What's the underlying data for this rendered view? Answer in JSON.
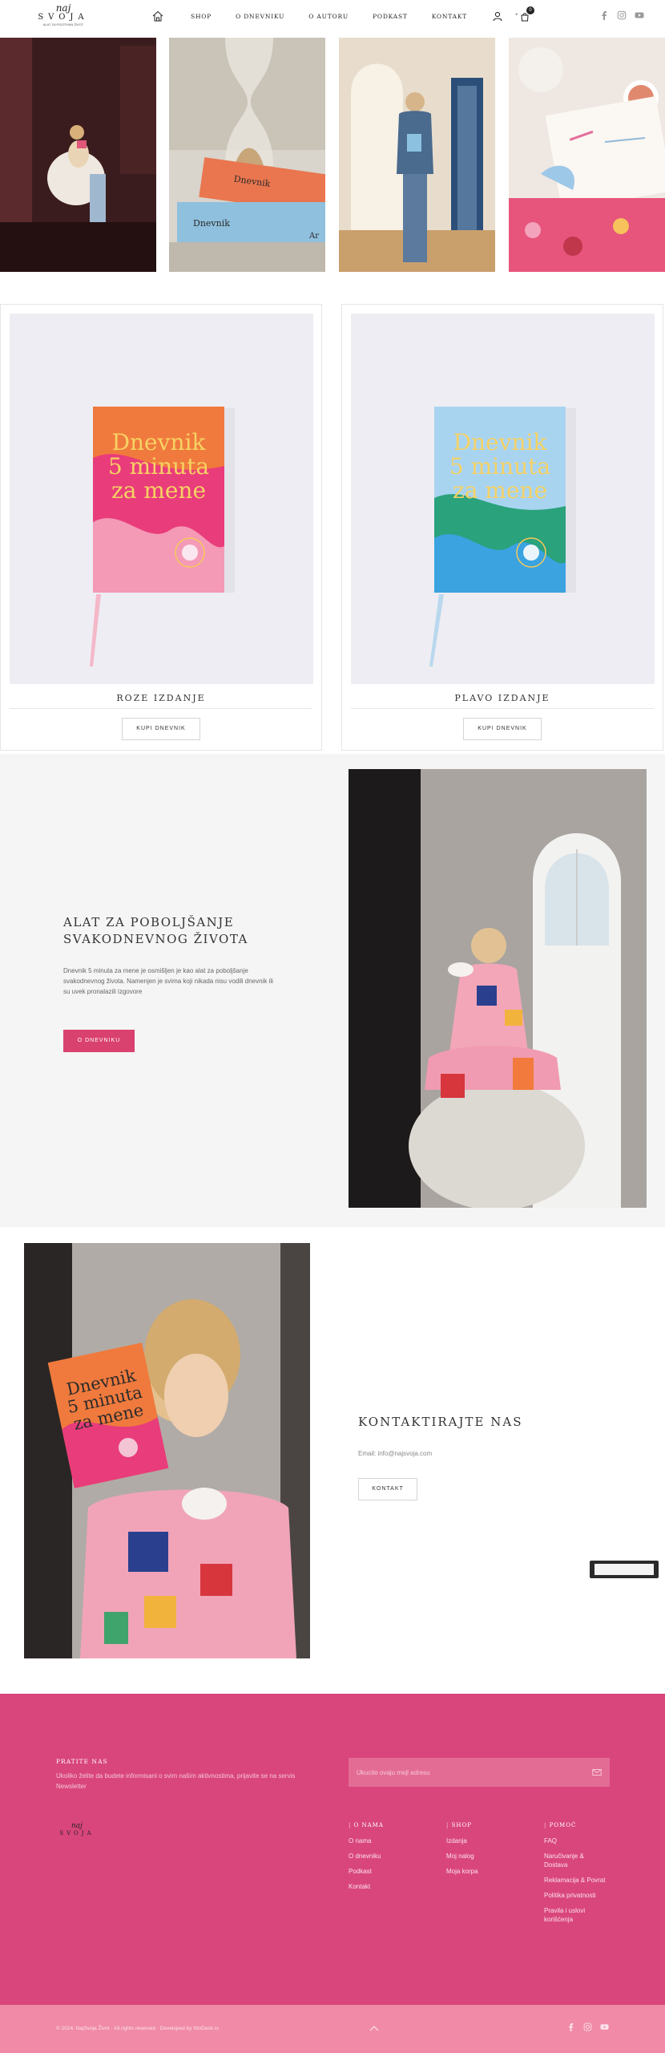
{
  "header": {
    "logo": {
      "line1": "naj",
      "line2": "SVOJA",
      "tagline": "ALAT ZA POZITIVAN ŽIVOT"
    },
    "nav": [
      "SHOP",
      "O DNEVNIKU",
      "O AUTORU",
      "PODKAST",
      "KONTAKT"
    ],
    "cart_plus": "+",
    "cart_count": "0",
    "icons": [
      "home-icon",
      "user-icon",
      "cart-icon",
      "facebook-icon",
      "instagram-icon",
      "youtube-icon"
    ]
  },
  "products": [
    {
      "name": "ROZE IZDANJE",
      "button": "KUPI DNEVNIK",
      "book_title": [
        "Dnevnik",
        "5 minuta",
        "za mene"
      ]
    },
    {
      "name": "PLAVO IZDANJE",
      "button": "KUPI DNEVNIK",
      "book_title": [
        "Dnevnik",
        "5 minuta",
        "za mene"
      ]
    }
  ],
  "strip_texts": {
    "book1": "Dnevnik",
    "book2": "Dnevnik",
    "book2_suffix": "Ar"
  },
  "feature": {
    "title": "ALAT ZA POBOLJŠANJE SVAKODNEVNOG ŽIVOTA",
    "description": "Dnevnik 5 minuta za mene je osmišljen je kao alat za poboljšanje svakodnevnog života. Namenjen je svima koji nikada nisu vodili dnevnik ili su uvek pronalazili izgovore",
    "button": "O DNEVNIKU"
  },
  "contact_photo_book": [
    "Dnevnik",
    "5 minuta",
    "za mene"
  ],
  "contact": {
    "title": "KONTAKTIRAJTE NAS",
    "email": "Email: info@najsvoja.com",
    "button": "KONTAKT"
  },
  "footer": {
    "follow_title": "PRATITE NAS",
    "follow_desc": "Ukoliko želite da budete informisani o svim našim aktivnostima, prijavite se na servis Newsletter",
    "email_placeholder": "Ukucite ovaju mejl adresu",
    "logo": {
      "line1": "naj",
      "line2": "SVOJA"
    },
    "columns": [
      {
        "title": "O NAMA",
        "items": [
          "O nama",
          "O dnevniku",
          "Podkast",
          "Kontakt"
        ]
      },
      {
        "title": "SHOP",
        "items": [
          "Izdanja",
          "Moj nalog",
          "Moja korpa"
        ]
      },
      {
        "title": "POMOĆ",
        "items": [
          "FAQ",
          "Naručivanje & Dostava",
          "Reklamacija & Povrat",
          "Politika privatnosti",
          "Pravila i uslovi korišćenja"
        ]
      }
    ],
    "copyright": "© 2024. NajSvoja Život · All rights reserved · Developed by WoDesk.rs"
  },
  "colors": {
    "accent": "#d9416f",
    "footer": "#d9467b",
    "bottom_bar": "#f08aa7",
    "product_bg": "#eeedf3"
  }
}
